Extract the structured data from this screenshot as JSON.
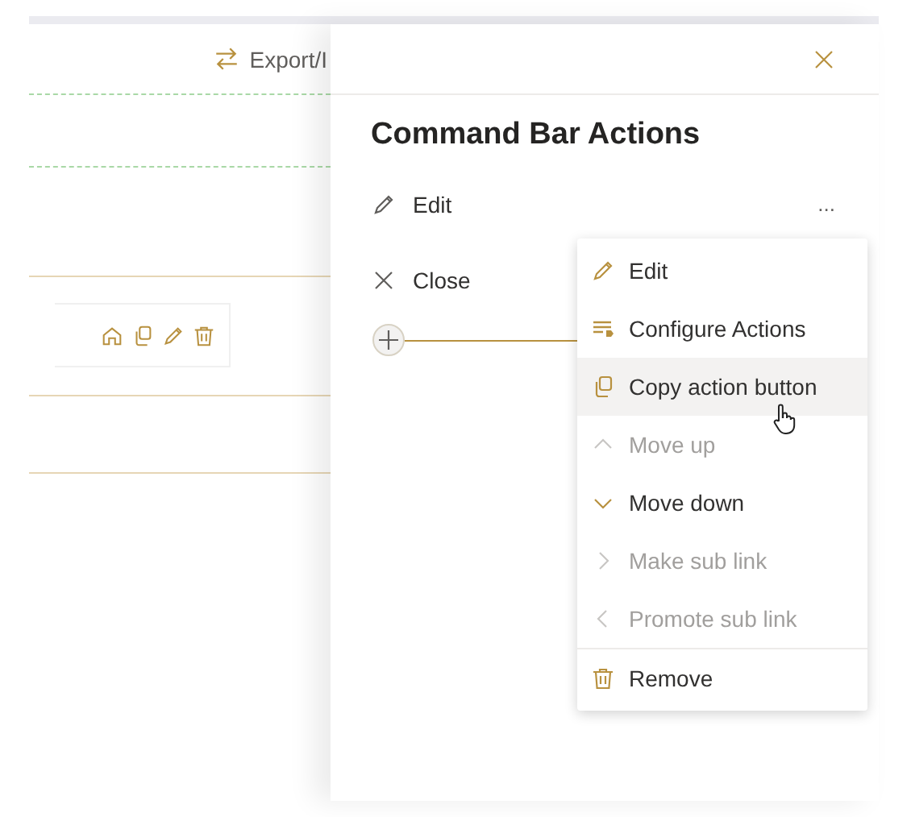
{
  "toolbar": {
    "export_label": "Export/I"
  },
  "panel": {
    "title": "Command Bar Actions",
    "actions": [
      {
        "kind": "edit",
        "label": "Edit",
        "more": "..."
      },
      {
        "kind": "close",
        "label": "Close"
      }
    ]
  },
  "menu": {
    "sections": [
      [
        {
          "kind": "edit",
          "label": "Edit",
          "disabled": false,
          "selected": false
        },
        {
          "kind": "configure",
          "label": "Configure Actions",
          "disabled": false,
          "selected": false
        },
        {
          "kind": "copy",
          "label": "Copy action button",
          "disabled": false,
          "selected": true
        },
        {
          "kind": "up",
          "label": "Move up",
          "disabled": true,
          "selected": false
        },
        {
          "kind": "down",
          "label": "Move down",
          "disabled": false,
          "selected": false
        },
        {
          "kind": "right",
          "label": "Make sub link",
          "disabled": true,
          "selected": false
        },
        {
          "kind": "left",
          "label": "Promote sub link",
          "disabled": true,
          "selected": false
        }
      ],
      [
        {
          "kind": "remove",
          "label": "Remove",
          "disabled": false,
          "selected": false
        }
      ]
    ]
  }
}
